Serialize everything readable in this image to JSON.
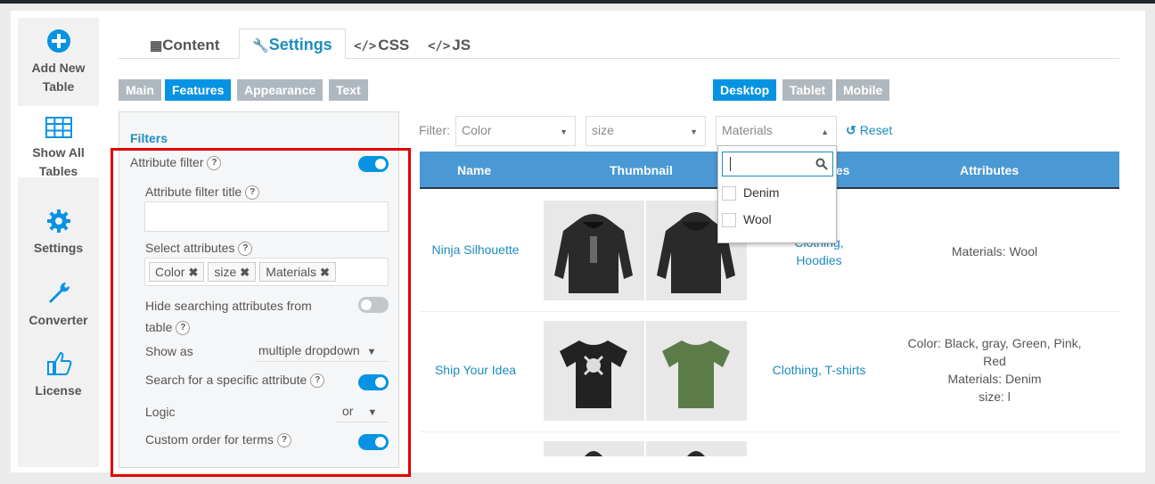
{
  "sidenav": {
    "items": [
      {
        "label": "Add New Table",
        "icon": "plus-circle-icon"
      },
      {
        "label": "Show All Tables",
        "icon": "table-grid-icon"
      },
      {
        "label": "Settings",
        "icon": "gear-icon"
      },
      {
        "label": "Converter",
        "icon": "wrench-icon"
      },
      {
        "label": "License",
        "icon": "thumbs-up-icon"
      }
    ]
  },
  "tabs": {
    "content": "Content",
    "settings": "Settings",
    "css": "CSS",
    "js": "JS"
  },
  "subtabs": [
    "Main",
    "Features",
    "Appearance",
    "Text"
  ],
  "device_tabs": [
    "Desktop",
    "Tablet",
    "Mobile"
  ],
  "panel": {
    "section_title": "Filters",
    "attribute_filter": "Attribute filter",
    "attribute_filter_title": "Attribute filter title",
    "attribute_filter_title_value": "",
    "select_attributes": "Select attributes",
    "chips": [
      "Color",
      "size",
      "Materials"
    ],
    "hide_searching_1": "Hide searching attributes from",
    "hide_searching_2": "table",
    "show_as": "Show as",
    "show_as_value": "multiple dropdown",
    "search_specific": "Search for a specific attribute",
    "logic": "Logic",
    "logic_value": "or",
    "custom_order": "Custom order for terms",
    "help": "?"
  },
  "preview": {
    "filter_label": "Filter:",
    "filters": [
      "Color",
      "size",
      "Materials"
    ],
    "reset": "Reset",
    "columns": [
      "Name",
      "Thumbnail",
      "Categories",
      "Attributes"
    ],
    "dropdown_options": [
      "Denim",
      "Wool"
    ],
    "rows": [
      {
        "name": "Ninja Silhouette",
        "categories_1": "Clothing,",
        "categories_2": "Hoodies",
        "attributes": [
          "Materials: Wool"
        ]
      },
      {
        "name": "Ship Your Idea",
        "categories_1": "Clothing, T-shirts",
        "categories_2": "",
        "attributes": [
          "Color: Black, gray, Green, Pink,",
          "Red",
          "Materials: Denim",
          "size: l"
        ]
      }
    ]
  },
  "colors": {
    "accent": "#0693e3",
    "header": "#4a98d4",
    "highlight": "#e00000"
  }
}
